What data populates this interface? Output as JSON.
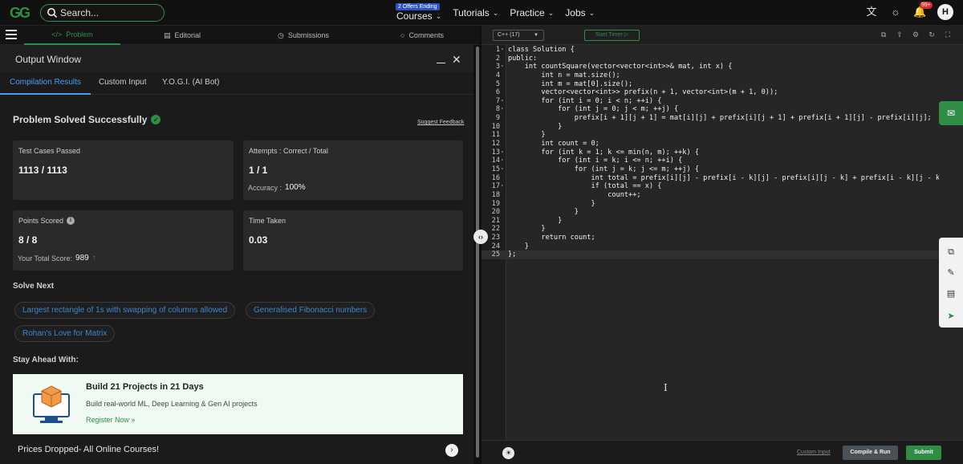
{
  "nav": {
    "logo": "GG",
    "search_placeholder": "Search...",
    "links": [
      {
        "label": "Courses",
        "badge": "2 Offers Ending"
      },
      {
        "label": "Tutorials"
      },
      {
        "label": "Practice"
      },
      {
        "label": "Jobs"
      }
    ],
    "notif_badge": "99+",
    "avatar_initial": "H"
  },
  "problem_tabs": [
    "Problem",
    "Editorial",
    "Submissions",
    "Comments"
  ],
  "output": {
    "title": "Output Window",
    "tabs": [
      "Compilation Results",
      "Custom Input",
      "Y.O.G.I. (AI Bot)"
    ],
    "status": "Problem Solved Successfully",
    "suggest_feedback": "Suggest Feedback",
    "test_cases_label": "Test Cases Passed",
    "test_cases_value": "1113 / 1113",
    "attempts_label": "Attempts : Correct / Total",
    "attempts_value": "1 / 1",
    "accuracy_label": "Accuracy :",
    "accuracy_value": "100%",
    "points_label": "Points Scored",
    "points_value": "8 / 8",
    "total_score_label": "Your Total Score:",
    "total_score_value": "989",
    "time_label": "Time Taken",
    "time_value": "0.03",
    "solve_next_title": "Solve Next",
    "solve_next": [
      "Largest rectangle of 1s with swapping of columns allowed",
      "Generalised Fibonacci numbers",
      "Rohan's Love for Matrix"
    ],
    "stay_ahead_title": "Stay Ahead With:",
    "promo": {
      "title": "Build 21 Projects in 21 Days",
      "subtitle": "Build real-world ML, Deep Learning & Gen AI projects",
      "link": "Register Now »"
    },
    "prices_banner": "Prices Dropped- All Online Courses!"
  },
  "editor": {
    "language": "C++ (17)",
    "start_timer": "Start Timer",
    "code_lines": [
      "class Solution {",
      "public:",
      "    int countSquare(vector<vector<int>>& mat, int x) {",
      "        int n = mat.size();",
      "        int m = mat[0].size();",
      "        vector<vector<int>> prefix(n + 1, vector<int>(m + 1, 0));",
      "        for (int i = 0; i < n; ++i) {",
      "            for (int j = 0; j < m; ++j) {",
      "                prefix[i + 1][j + 1] = mat[i][j] + prefix[i][j + 1] + prefix[i + 1][j] - prefix[i][j];",
      "            }",
      "        }",
      "        int count = 0;",
      "        for (int k = 1; k <= min(n, m); ++k) {",
      "            for (int i = k; i <= n; ++i) {",
      "                for (int j = k; j <= m; ++j) {",
      "                    int total = prefix[i][j] - prefix[i - k][j] - prefix[i][j - k] + prefix[i - k][j - k];",
      "                    if (total == x) {",
      "                        count++;",
      "                    }",
      "                }",
      "            }",
      "        }",
      "        return count;",
      "    }",
      "};"
    ],
    "fold_lines": [
      1,
      3,
      7,
      8,
      13,
      14,
      15,
      17
    ],
    "custom_input": "Custom Input",
    "compile_run": "Compile & Run",
    "submit": "Submit"
  },
  "colors": {
    "brand_green": "#2f8d46",
    "link_blue": "#4a9df0",
    "chip_text": "#3c86cf"
  }
}
